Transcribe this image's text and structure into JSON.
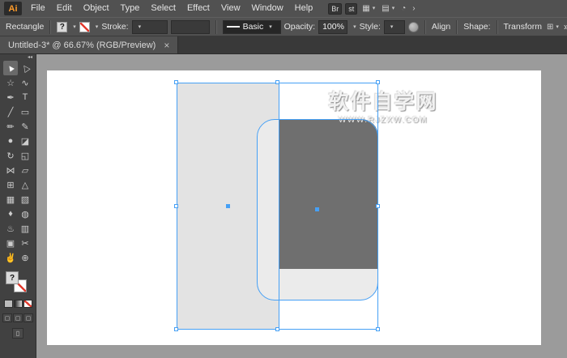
{
  "app": {
    "logo_text": "Ai",
    "menus": [
      "File",
      "Edit",
      "Object",
      "Type",
      "Select",
      "Effect",
      "View",
      "Window",
      "Help"
    ],
    "bridge_badge": "Br",
    "stock_badge": "st",
    "workspace_icon_glyph": "▦",
    "layout_icon_glyph": "▤",
    "status_circle_glyph": "◔",
    "chevron_glyph": "›"
  },
  "control_bar": {
    "context_label": "Rectangle",
    "fill_indicator": "?",
    "stroke_label": "Stroke:",
    "brush_name": "Basic",
    "opacity_label": "Opacity:",
    "opacity_value": "100%",
    "style_label": "Style:",
    "align_label": "Align",
    "shape_label": "Shape:",
    "transform_label": "Transform",
    "transform_icon_glyph": "⊞",
    "overflow_glyph": "»"
  },
  "document_tab": {
    "title": "Untitled-3* @ 66.67% (RGB/Preview)",
    "close_glyph": "×"
  },
  "toolbar": {
    "collapse_glyph": "◂◂",
    "fill_indicator": "?",
    "draw_mode_glyph": "▢",
    "screen_mode_glyph": "▯",
    "tools": [
      {
        "id": "selection-tool",
        "glyph": "►",
        "active": true
      },
      {
        "id": "direct-selection-tool",
        "glyph": "▷",
        "active": false
      },
      {
        "id": "magic-wand-tool",
        "glyph": "☆",
        "active": false
      },
      {
        "id": "lasso-tool",
        "glyph": "∿",
        "active": false
      },
      {
        "id": "pen-tool",
        "glyph": "✒",
        "active": false
      },
      {
        "id": "type-tool",
        "glyph": "T",
        "active": false
      },
      {
        "id": "line-segment-tool",
        "glyph": "╱",
        "active": false
      },
      {
        "id": "rectangle-tool",
        "glyph": "▭",
        "active": false
      },
      {
        "id": "paintbrush-tool",
        "glyph": "✏",
        "active": false
      },
      {
        "id": "pencil-tool",
        "glyph": "✎",
        "active": false
      },
      {
        "id": "blob-brush-tool",
        "glyph": "●",
        "active": false
      },
      {
        "id": "eraser-tool",
        "glyph": "◪",
        "active": false
      },
      {
        "id": "rotate-tool",
        "glyph": "↻",
        "active": false
      },
      {
        "id": "scale-tool",
        "glyph": "◱",
        "active": false
      },
      {
        "id": "width-tool",
        "glyph": "⋈",
        "active": false
      },
      {
        "id": "free-transform-tool",
        "glyph": "▱",
        "active": false
      },
      {
        "id": "shape-builder-tool",
        "glyph": "⊞",
        "active": false
      },
      {
        "id": "perspective-grid-tool",
        "glyph": "△",
        "active": false
      },
      {
        "id": "mesh-tool",
        "glyph": "▦",
        "active": false
      },
      {
        "id": "gradient-tool",
        "glyph": "▧",
        "active": false
      },
      {
        "id": "eyedropper-tool",
        "glyph": "♦",
        "active": false
      },
      {
        "id": "blend-tool",
        "glyph": "◍",
        "active": false
      },
      {
        "id": "symbol-sprayer-tool",
        "glyph": "♨",
        "active": false
      },
      {
        "id": "column-graph-tool",
        "glyph": "▥",
        "active": false
      },
      {
        "id": "artboard-tool",
        "glyph": "▣",
        "active": false
      },
      {
        "id": "slice-tool",
        "glyph": "✂",
        "active": false
      },
      {
        "id": "hand-tool",
        "glyph": "✌",
        "active": false
      },
      {
        "id": "zoom-tool",
        "glyph": "⊕",
        "active": false
      }
    ]
  },
  "canvas": {
    "watermark_line1": "软件自学网",
    "watermark_line2": "WWW.RJZXW.COM",
    "colors": {
      "selection_blue": "#46a0f5",
      "light_rect_fill": "#e3e3e3",
      "dark_rect_fill": "#6f6f6f",
      "rounded_rect_fill": "#ebebeb",
      "artboard": "#ffffff",
      "pasteboard": "#9b9b9b"
    }
  }
}
